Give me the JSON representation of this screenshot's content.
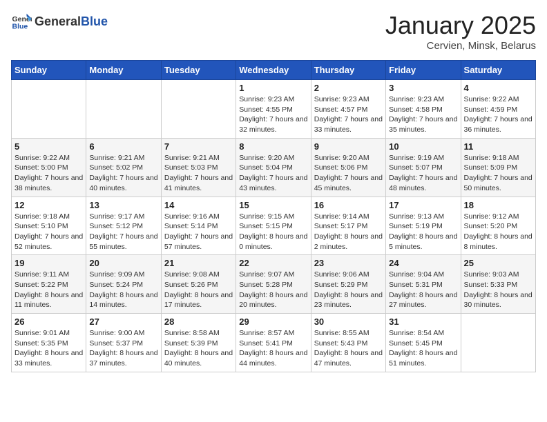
{
  "header": {
    "logo_general": "General",
    "logo_blue": "Blue",
    "title": "January 2025",
    "subtitle": "Cervien, Minsk, Belarus"
  },
  "weekdays": [
    "Sunday",
    "Monday",
    "Tuesday",
    "Wednesday",
    "Thursday",
    "Friday",
    "Saturday"
  ],
  "weeks": [
    [
      {
        "day": "",
        "sunrise": "",
        "sunset": "",
        "daylight": ""
      },
      {
        "day": "",
        "sunrise": "",
        "sunset": "",
        "daylight": ""
      },
      {
        "day": "",
        "sunrise": "",
        "sunset": "",
        "daylight": ""
      },
      {
        "day": "1",
        "sunrise": "Sunrise: 9:23 AM",
        "sunset": "Sunset: 4:55 PM",
        "daylight": "Daylight: 7 hours and 32 minutes."
      },
      {
        "day": "2",
        "sunrise": "Sunrise: 9:23 AM",
        "sunset": "Sunset: 4:57 PM",
        "daylight": "Daylight: 7 hours and 33 minutes."
      },
      {
        "day": "3",
        "sunrise": "Sunrise: 9:23 AM",
        "sunset": "Sunset: 4:58 PM",
        "daylight": "Daylight: 7 hours and 35 minutes."
      },
      {
        "day": "4",
        "sunrise": "Sunrise: 9:22 AM",
        "sunset": "Sunset: 4:59 PM",
        "daylight": "Daylight: 7 hours and 36 minutes."
      }
    ],
    [
      {
        "day": "5",
        "sunrise": "Sunrise: 9:22 AM",
        "sunset": "Sunset: 5:00 PM",
        "daylight": "Daylight: 7 hours and 38 minutes."
      },
      {
        "day": "6",
        "sunrise": "Sunrise: 9:21 AM",
        "sunset": "Sunset: 5:02 PM",
        "daylight": "Daylight: 7 hours and 40 minutes."
      },
      {
        "day": "7",
        "sunrise": "Sunrise: 9:21 AM",
        "sunset": "Sunset: 5:03 PM",
        "daylight": "Daylight: 7 hours and 41 minutes."
      },
      {
        "day": "8",
        "sunrise": "Sunrise: 9:20 AM",
        "sunset": "Sunset: 5:04 PM",
        "daylight": "Daylight: 7 hours and 43 minutes."
      },
      {
        "day": "9",
        "sunrise": "Sunrise: 9:20 AM",
        "sunset": "Sunset: 5:06 PM",
        "daylight": "Daylight: 7 hours and 45 minutes."
      },
      {
        "day": "10",
        "sunrise": "Sunrise: 9:19 AM",
        "sunset": "Sunset: 5:07 PM",
        "daylight": "Daylight: 7 hours and 48 minutes."
      },
      {
        "day": "11",
        "sunrise": "Sunrise: 9:18 AM",
        "sunset": "Sunset: 5:09 PM",
        "daylight": "Daylight: 7 hours and 50 minutes."
      }
    ],
    [
      {
        "day": "12",
        "sunrise": "Sunrise: 9:18 AM",
        "sunset": "Sunset: 5:10 PM",
        "daylight": "Daylight: 7 hours and 52 minutes."
      },
      {
        "day": "13",
        "sunrise": "Sunrise: 9:17 AM",
        "sunset": "Sunset: 5:12 PM",
        "daylight": "Daylight: 7 hours and 55 minutes."
      },
      {
        "day": "14",
        "sunrise": "Sunrise: 9:16 AM",
        "sunset": "Sunset: 5:14 PM",
        "daylight": "Daylight: 7 hours and 57 minutes."
      },
      {
        "day": "15",
        "sunrise": "Sunrise: 9:15 AM",
        "sunset": "Sunset: 5:15 PM",
        "daylight": "Daylight: 8 hours and 0 minutes."
      },
      {
        "day": "16",
        "sunrise": "Sunrise: 9:14 AM",
        "sunset": "Sunset: 5:17 PM",
        "daylight": "Daylight: 8 hours and 2 minutes."
      },
      {
        "day": "17",
        "sunrise": "Sunrise: 9:13 AM",
        "sunset": "Sunset: 5:19 PM",
        "daylight": "Daylight: 8 hours and 5 minutes."
      },
      {
        "day": "18",
        "sunrise": "Sunrise: 9:12 AM",
        "sunset": "Sunset: 5:20 PM",
        "daylight": "Daylight: 8 hours and 8 minutes."
      }
    ],
    [
      {
        "day": "19",
        "sunrise": "Sunrise: 9:11 AM",
        "sunset": "Sunset: 5:22 PM",
        "daylight": "Daylight: 8 hours and 11 minutes."
      },
      {
        "day": "20",
        "sunrise": "Sunrise: 9:09 AM",
        "sunset": "Sunset: 5:24 PM",
        "daylight": "Daylight: 8 hours and 14 minutes."
      },
      {
        "day": "21",
        "sunrise": "Sunrise: 9:08 AM",
        "sunset": "Sunset: 5:26 PM",
        "daylight": "Daylight: 8 hours and 17 minutes."
      },
      {
        "day": "22",
        "sunrise": "Sunrise: 9:07 AM",
        "sunset": "Sunset: 5:28 PM",
        "daylight": "Daylight: 8 hours and 20 minutes."
      },
      {
        "day": "23",
        "sunrise": "Sunrise: 9:06 AM",
        "sunset": "Sunset: 5:29 PM",
        "daylight": "Daylight: 8 hours and 23 minutes."
      },
      {
        "day": "24",
        "sunrise": "Sunrise: 9:04 AM",
        "sunset": "Sunset: 5:31 PM",
        "daylight": "Daylight: 8 hours and 27 minutes."
      },
      {
        "day": "25",
        "sunrise": "Sunrise: 9:03 AM",
        "sunset": "Sunset: 5:33 PM",
        "daylight": "Daylight: 8 hours and 30 minutes."
      }
    ],
    [
      {
        "day": "26",
        "sunrise": "Sunrise: 9:01 AM",
        "sunset": "Sunset: 5:35 PM",
        "daylight": "Daylight: 8 hours and 33 minutes."
      },
      {
        "day": "27",
        "sunrise": "Sunrise: 9:00 AM",
        "sunset": "Sunset: 5:37 PM",
        "daylight": "Daylight: 8 hours and 37 minutes."
      },
      {
        "day": "28",
        "sunrise": "Sunrise: 8:58 AM",
        "sunset": "Sunset: 5:39 PM",
        "daylight": "Daylight: 8 hours and 40 minutes."
      },
      {
        "day": "29",
        "sunrise": "Sunrise: 8:57 AM",
        "sunset": "Sunset: 5:41 PM",
        "daylight": "Daylight: 8 hours and 44 minutes."
      },
      {
        "day": "30",
        "sunrise": "Sunrise: 8:55 AM",
        "sunset": "Sunset: 5:43 PM",
        "daylight": "Daylight: 8 hours and 47 minutes."
      },
      {
        "day": "31",
        "sunrise": "Sunrise: 8:54 AM",
        "sunset": "Sunset: 5:45 PM",
        "daylight": "Daylight: 8 hours and 51 minutes."
      },
      {
        "day": "",
        "sunrise": "",
        "sunset": "",
        "daylight": ""
      }
    ]
  ]
}
